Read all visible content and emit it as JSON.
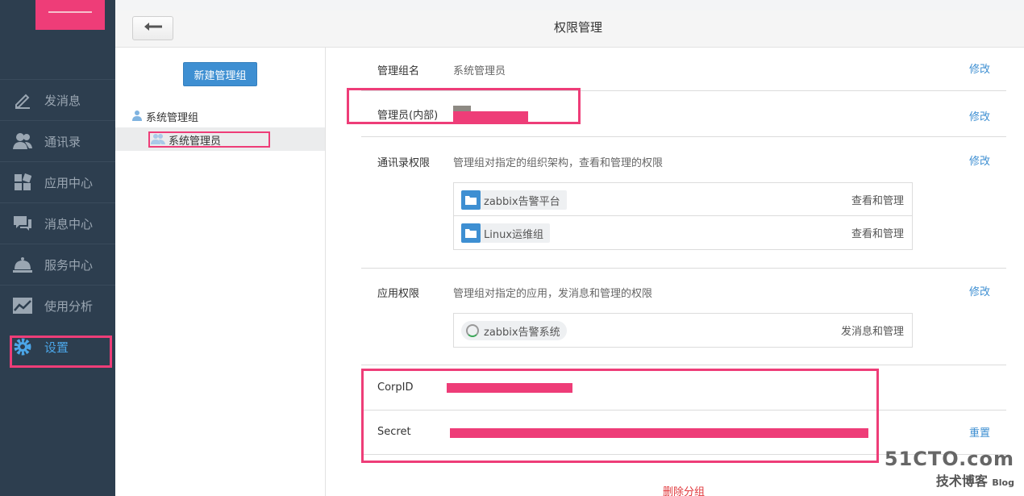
{
  "nav": {
    "items": [
      {
        "label": "发消息",
        "icon": "pencil-icon"
      },
      {
        "label": "通讯录",
        "icon": "contacts-icon"
      },
      {
        "label": "应用中心",
        "icon": "apps-icon"
      },
      {
        "label": "消息中心",
        "icon": "chat-icon"
      },
      {
        "label": "服务中心",
        "icon": "bell-service-icon"
      },
      {
        "label": "使用分析",
        "icon": "chart-icon"
      },
      {
        "label": "设置",
        "icon": "gear-icon",
        "active": true
      }
    ],
    "active_color": "#4ba6e8"
  },
  "header": {
    "title": "权限管理"
  },
  "groups": {
    "new_group_button": "新建管理组",
    "parent": "系统管理组",
    "child": "系统管理员"
  },
  "detail": {
    "group_name_label": "管理组名",
    "group_name_value": "系统管理员",
    "edit_label": "修改",
    "admin_label": "管理员(内部)",
    "contacts_label": "通讯录权限",
    "contacts_desc": "管理组对指定的组织架构，查看和管理的权限",
    "contacts_items": [
      {
        "name": "zabbix告警平台",
        "perm": "查看和管理"
      },
      {
        "name": "Linux运维组",
        "perm": "查看和管理"
      }
    ],
    "apps_label": "应用权限",
    "apps_desc": "管理组对指定的应用，发消息和管理的权限",
    "apps_items": [
      {
        "name": "zabbix告警系统",
        "perm": "发消息和管理"
      }
    ],
    "corpid_label": "CorpID",
    "secret_label": "Secret",
    "reset_label": "重置",
    "delete_label": "删除分组"
  },
  "watermark": {
    "main": "51CTO.com",
    "sub": "技术博客",
    "sub2": "Blog"
  },
  "colors": {
    "brand": "#3e8fd2",
    "highlight": "#ee3d78",
    "danger": "#e0383c",
    "nav_bg": "#2d3e4f"
  }
}
